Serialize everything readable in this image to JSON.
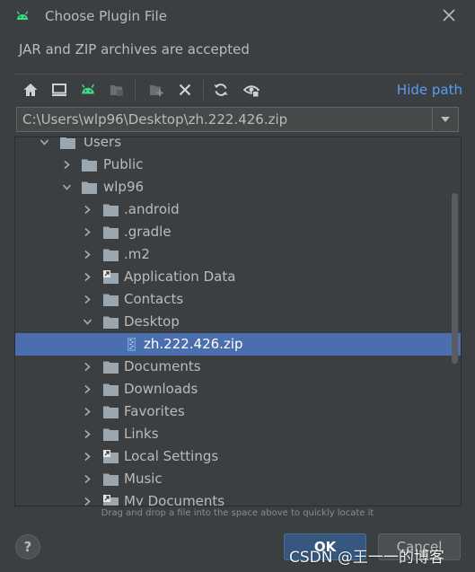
{
  "window": {
    "title": "Choose Plugin File",
    "subtitle": "JAR and ZIP archives are accepted"
  },
  "toolbar": {
    "buttons": [
      {
        "name": "home-button",
        "icon": "home-icon"
      },
      {
        "name": "desktop-button",
        "icon": "desktop-icon"
      },
      {
        "name": "project-button",
        "icon": "android-icon"
      },
      {
        "name": "module-button",
        "icon": "module-folder-icon"
      },
      {
        "name": "new-folder-button",
        "icon": "new-folder-icon"
      },
      {
        "name": "delete-button",
        "icon": "delete-icon"
      },
      {
        "name": "refresh-button",
        "icon": "refresh-icon"
      },
      {
        "name": "show-hidden-button",
        "icon": "show-hidden-icon"
      }
    ],
    "hide_path_label": "Hide path"
  },
  "path": {
    "value": "C:\\Users\\wlp96\\Desktop\\zh.222.426.zip"
  },
  "tree": {
    "items": [
      {
        "label": "Users",
        "depth": 0,
        "state": "expanded",
        "type": "folder"
      },
      {
        "label": "Public",
        "depth": 1,
        "state": "collapsed",
        "type": "folder"
      },
      {
        "label": "wlp96",
        "depth": 1,
        "state": "expanded",
        "type": "folder"
      },
      {
        "label": ".android",
        "depth": 2,
        "state": "collapsed",
        "type": "folder"
      },
      {
        "label": ".gradle",
        "depth": 2,
        "state": "collapsed",
        "type": "folder"
      },
      {
        "label": ".m2",
        "depth": 2,
        "state": "collapsed",
        "type": "folder"
      },
      {
        "label": "Application Data",
        "depth": 2,
        "state": "collapsed",
        "type": "link"
      },
      {
        "label": "Contacts",
        "depth": 2,
        "state": "collapsed",
        "type": "folder"
      },
      {
        "label": "Desktop",
        "depth": 2,
        "state": "expanded",
        "type": "folder"
      },
      {
        "label": "zh.222.426.zip",
        "depth": 3,
        "state": "leaf",
        "type": "archive",
        "selected": true
      },
      {
        "label": "Documents",
        "depth": 2,
        "state": "collapsed",
        "type": "folder"
      },
      {
        "label": "Downloads",
        "depth": 2,
        "state": "collapsed",
        "type": "folder"
      },
      {
        "label": "Favorites",
        "depth": 2,
        "state": "collapsed",
        "type": "folder"
      },
      {
        "label": "Links",
        "depth": 2,
        "state": "collapsed",
        "type": "folder"
      },
      {
        "label": "Local Settings",
        "depth": 2,
        "state": "collapsed",
        "type": "link"
      },
      {
        "label": "Music",
        "depth": 2,
        "state": "collapsed",
        "type": "folder"
      },
      {
        "label": "My Documents",
        "depth": 2,
        "state": "collapsed",
        "type": "link"
      }
    ]
  },
  "hint": "Drag and drop a file into the space above to quickly locate it",
  "buttons": {
    "help": "?",
    "ok": "OK",
    "cancel": "Cancel"
  },
  "watermark": "CSDN @王一一的博客",
  "colors": {
    "background": "#3c3f41",
    "selection": "#4b6eaf",
    "accent_link": "#589df6",
    "android_green": "#3ddc84",
    "folder": "#9aa7b0",
    "ok_button": "#365880"
  }
}
